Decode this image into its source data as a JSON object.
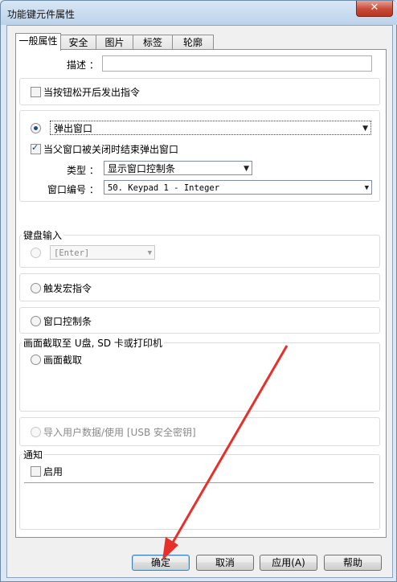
{
  "window": {
    "title": "功能键元件属性",
    "close_symbol": "✕"
  },
  "tabs": [
    "一般属性",
    "安全",
    "图片",
    "标签",
    "轮廓"
  ],
  "general": {
    "description_label": "描述 ：",
    "description_value": "",
    "release_checkbox_label": "当按钮松开后发出指令",
    "release_checked": false
  },
  "popup": {
    "radio_checked": true,
    "combo_value": "弹出窗口",
    "close_checkbox_label": "当父窗口被关闭时结束弹出窗口",
    "close_checked": true,
    "type_label": "类型 ：",
    "type_value": "显示窗口控制条",
    "window_no_label": "窗口编号 ：",
    "window_no_value": "50. Keypad 1 - Integer"
  },
  "keyboard": {
    "group_title": "键盘输入",
    "combo_value": "[Enter]"
  },
  "macro": {
    "label": "触发宏指令"
  },
  "window_bar": {
    "label": "窗口控制条"
  },
  "capture": {
    "group_title": "画面截取至 U盘, SD 卡或打印机",
    "label": "画面截取"
  },
  "import": {
    "label": "导入用户数据/使用 [USB 安全密钥]"
  },
  "notify": {
    "group_title": "通知",
    "enable_label": "启用",
    "enabled": false
  },
  "buttons": {
    "ok": "确定",
    "cancel": "取消",
    "apply": "应用(A)",
    "help": "帮助"
  },
  "annotation": {
    "arrow_color": "#e8302a"
  }
}
